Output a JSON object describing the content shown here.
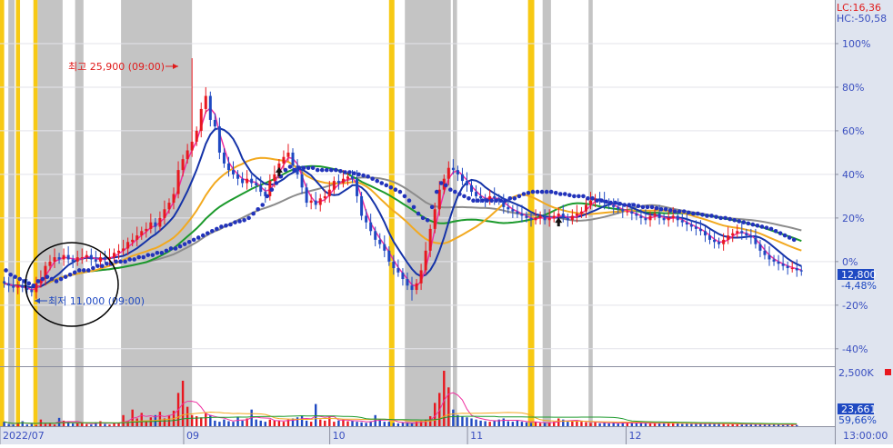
{
  "header": {
    "lc_label": "LC:16,36",
    "hc_label": "HC:-50,58"
  },
  "axis": {
    "x_tick_labels": [
      "2022/07",
      "09",
      "10",
      "11",
      "12"
    ],
    "price_pct_labels": [
      "100%",
      "80%",
      "60%",
      "40%",
      "20%",
      "0%",
      "-20%",
      "-40%"
    ],
    "volume_label": "2,500K",
    "time_label": "13:00:00"
  },
  "annotations": {
    "high_label": "최고 25,900 (09:00)",
    "low_label": "최저 11,000 (09:00)"
  },
  "readouts": {
    "price_value": "12,800",
    "price_change": "-4,48%",
    "volume_value": "23,661",
    "volume_pct": "59,66%"
  },
  "colors": {
    "up": "#e8181f",
    "down": "#1f49c2",
    "gray_band": "#c4c4c4",
    "yellow_band": "#f7c914",
    "ma_pink": "#ef2fa0",
    "ma_navy": "#1533a8",
    "ma_orange": "#f2a91f",
    "ma_green": "#1c9a2c",
    "ma_gray": "#8c8c8c",
    "sar_dot": "#2233bb",
    "axis_bg": "#dfe4ef",
    "axis_text": "#3a4fc0",
    "header_red": "#e01b1b",
    "readout_bg": "#1f49c2"
  },
  "chart_data": {
    "type": "candlestick",
    "xlim": [
      0,
      200
    ],
    "ylim_pct": [
      -48,
      120
    ],
    "base_price": 13400,
    "y_tick_pct": [
      100,
      80,
      60,
      40,
      20,
      0,
      -20,
      -40
    ],
    "x_ticks": [
      {
        "x": 0,
        "label": "2022/07"
      },
      {
        "x": 44,
        "label": "09"
      },
      {
        "x": 79,
        "label": "10"
      },
      {
        "x": 112,
        "label": "11"
      },
      {
        "x": 150,
        "label": "12"
      }
    ],
    "gray_bands": [
      [
        2,
        3.5
      ],
      [
        9,
        15
      ],
      [
        18,
        20
      ],
      [
        29,
        46
      ],
      [
        97,
        108
      ],
      [
        108.5,
        109.5
      ],
      [
        130,
        132
      ],
      [
        141,
        142
      ]
    ],
    "yellow_bands": [
      [
        0,
        1
      ],
      [
        3.8,
        4.8
      ],
      [
        8,
        9
      ],
      [
        93.2,
        94.5
      ],
      [
        126.5,
        128
      ]
    ],
    "close_pct": [
      -10,
      -11,
      -12,
      -11,
      -12,
      -13,
      -14,
      -10,
      -8,
      -2,
      0,
      2,
      1,
      3,
      1,
      0,
      2,
      2,
      3,
      1,
      0,
      2,
      1,
      2,
      4,
      5,
      6,
      9,
      10,
      12,
      14,
      15,
      18,
      16,
      20,
      24,
      27,
      31,
      42,
      47,
      51,
      55,
      60,
      70,
      76,
      65,
      62,
      50,
      45,
      42,
      40,
      38,
      36,
      38,
      36,
      35,
      32,
      30,
      37,
      40,
      45,
      48,
      50,
      44,
      40,
      34,
      27,
      28,
      26,
      29,
      30,
      33,
      37,
      36,
      38,
      39,
      38,
      30,
      21,
      18,
      14,
      10,
      8,
      5,
      0,
      -3,
      -5,
      -8,
      -11,
      -13,
      -10,
      -4,
      5,
      15,
      24,
      33,
      38,
      43,
      42,
      40,
      37,
      35,
      32,
      30,
      29,
      28,
      30,
      29,
      28,
      25,
      24,
      23,
      22,
      21,
      20,
      19,
      20,
      21,
      19,
      20,
      21,
      22,
      20,
      19,
      21,
      22,
      23,
      26,
      28,
      29,
      28,
      27,
      26,
      25,
      24,
      23,
      23,
      22,
      21,
      20,
      19,
      21,
      22,
      20,
      19,
      20,
      21,
      19,
      18,
      17,
      16,
      15,
      14,
      12,
      10,
      9,
      8,
      10,
      12,
      13,
      14,
      13,
      12,
      11,
      8,
      5,
      3,
      1,
      0,
      -1,
      -2,
      -3,
      -3,
      -4,
      -4.5
    ],
    "high_pct": 93.3,
    "low_pct": -17.9,
    "sar_pct": [
      -4,
      -6,
      -7,
      -8,
      -9,
      -10,
      -11,
      -9,
      -8,
      -7,
      -8,
      -9,
      -8,
      -7,
      -6,
      -5,
      -4,
      -4,
      -4,
      -3,
      -2,
      -2,
      -1,
      -1,
      0,
      0,
      0,
      1,
      1,
      2,
      2,
      3,
      3,
      4,
      4,
      5,
      6,
      6,
      7,
      8,
      9,
      10,
      11,
      12,
      13,
      14,
      15,
      16,
      16.5,
      17,
      18,
      18.5,
      19,
      20,
      22,
      24,
      26,
      30,
      33,
      36,
      39,
      42,
      43.5,
      42,
      43,
      43,
      43,
      43,
      42,
      42,
      42,
      42,
      42,
      41.5,
      41,
      41,
      40.5,
      40,
      39.5,
      39,
      38,
      37,
      36,
      35,
      34,
      33,
      32,
      30,
      28,
      25,
      22,
      20,
      19,
      25,
      32,
      36,
      35,
      33,
      32,
      31,
      30,
      29,
      28,
      28,
      28,
      28,
      28,
      28,
      28,
      28,
      29,
      29,
      30,
      31,
      31.5,
      32,
      32,
      32,
      32,
      32,
      31.5,
      31,
      31,
      30.5,
      30,
      30,
      30,
      29,
      29,
      28,
      28,
      27.5,
      27,
      27,
      26.5,
      26,
      26,
      26,
      25.5,
      25,
      25,
      25,
      24.5,
      24,
      24,
      23.5,
      23,
      23,
      23,
      22.5,
      22,
      22,
      21.5,
      21,
      21,
      20.5,
      20,
      20,
      19.5,
      19,
      18.5,
      18,
      17.5,
      17,
      16.5,
      16,
      15.5,
      15,
      14,
      13,
      12,
      11,
      10
    ],
    "volume_pct": [
      8,
      4,
      3,
      6,
      9,
      3,
      4,
      2,
      12,
      4,
      6,
      3,
      15,
      10,
      8,
      5,
      5,
      6,
      4,
      3,
      7,
      9,
      4,
      3,
      5,
      6,
      20,
      10,
      30,
      14,
      24,
      10,
      16,
      20,
      26,
      14,
      20,
      28,
      60,
      82,
      35,
      20,
      18,
      16,
      24,
      20,
      10,
      8,
      12,
      9,
      8,
      16,
      10,
      14,
      30,
      12,
      10,
      8,
      12,
      10,
      9,
      8,
      12,
      14,
      16,
      18,
      10,
      8,
      40,
      12,
      10,
      16,
      8,
      10,
      12,
      9,
      10,
      8,
      7,
      6,
      9,
      20,
      12,
      8,
      8,
      6,
      5,
      7,
      6,
      5,
      8,
      10,
      12,
      18,
      42,
      60,
      100,
      70,
      30,
      20,
      18,
      16,
      14,
      12,
      10,
      9,
      8,
      10,
      12,
      14,
      9,
      8,
      10,
      8,
      7,
      6,
      8,
      6,
      6,
      6,
      8,
      14,
      12,
      8,
      10,
      9,
      8,
      7,
      6,
      8,
      5,
      6,
      5,
      6,
      5,
      7,
      6,
      6,
      5,
      5,
      6,
      5,
      6,
      5,
      6,
      5,
      6,
      5,
      4,
      5,
      4,
      5,
      4,
      4,
      5,
      4,
      5,
      4,
      3,
      4,
      4,
      3,
      4,
      3,
      3,
      3,
      4,
      3,
      3,
      3,
      2,
      3,
      3,
      2
    ],
    "volume_max_label": "2,500K"
  }
}
